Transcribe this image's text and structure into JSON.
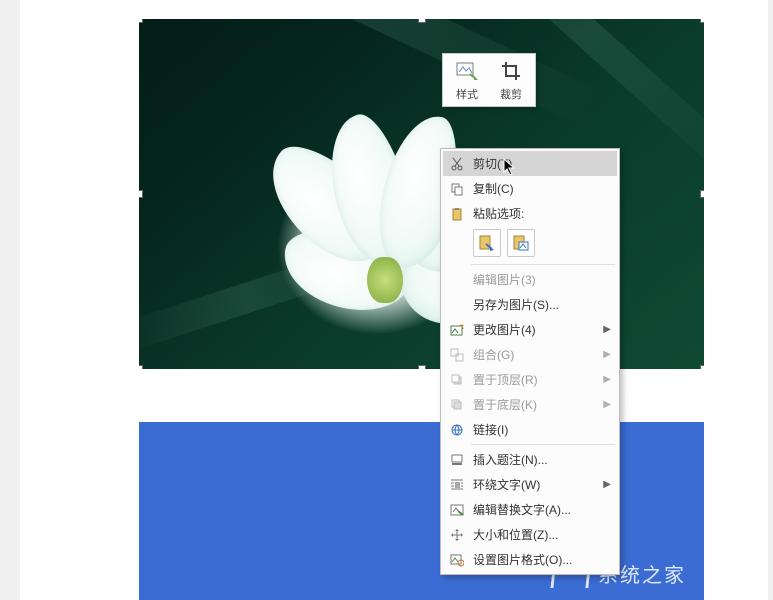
{
  "mini_toolbar": {
    "style_label": "样式",
    "crop_label": "裁剪"
  },
  "context_menu": {
    "cut": "剪切(T)",
    "copy": "复制(C)",
    "paste_options": "粘贴选项:",
    "edit_picture": "编辑图片(3)",
    "save_as_picture": "另存为图片(S)...",
    "change_picture": "更改图片(4)",
    "group": "组合(G)",
    "bring_to_front": "置于顶层(R)",
    "send_to_back": "置于底层(K)",
    "hyperlink": "链接(I)",
    "insert_caption": "插入题注(N)...",
    "wrap_text": "环绕文字(W)",
    "edit_alt_text": "编辑替换文字(A)...",
    "size_and_position": "大小和位置(Z)...",
    "format_picture": "设置图片格式(O)..."
  },
  "watermark_text": "系统之家"
}
